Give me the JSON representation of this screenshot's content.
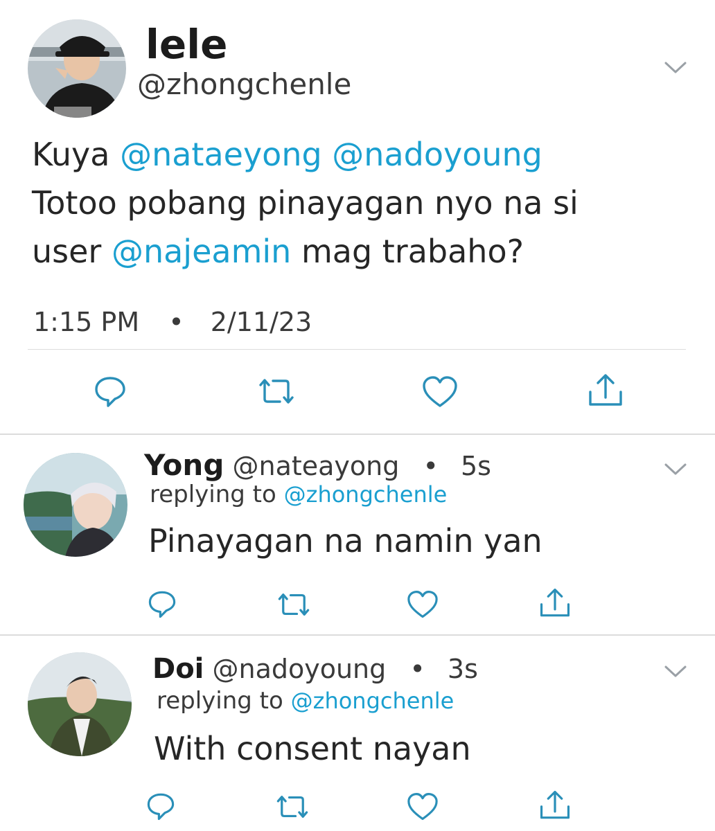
{
  "main_tweet": {
    "display_name": "lele",
    "handle": "@zhongchenle",
    "body": {
      "prefix": "Kuya",
      "mention1": "@nataeyong",
      "mention2": "@nadoyoung",
      "line2": "Totoo pobang pinayagan nyo na si",
      "line3_prefix": "user",
      "mention3": "@najeamin",
      "line3_suffix": "mag trabaho?"
    },
    "time": "1:15 PM",
    "separator": "•",
    "date": "2/11/23"
  },
  "replies": [
    {
      "display_name": "Yong",
      "handle": "@nateayong",
      "separator": "•",
      "age": "5s",
      "replying_label": "replying to",
      "replying_handle": "@zhongchenle",
      "text": "Pinayagan na namin yan"
    },
    {
      "display_name": "Doi",
      "handle": "@nadoyoung",
      "separator": "•",
      "age": "3s",
      "replying_label": "replying to",
      "replying_handle": "@zhongchenle",
      "text": "With consent nayan"
    }
  ],
  "icons": {
    "reply": "reply-icon",
    "retweet": "retweet-icon",
    "like": "heart-icon",
    "share": "share-icon",
    "menu": "chevron-down-icon"
  },
  "colors": {
    "mention": "#1a9fd0",
    "icon": "#2a8fb8",
    "text": "#1c1c1c",
    "divider": "#dcdcdc"
  }
}
